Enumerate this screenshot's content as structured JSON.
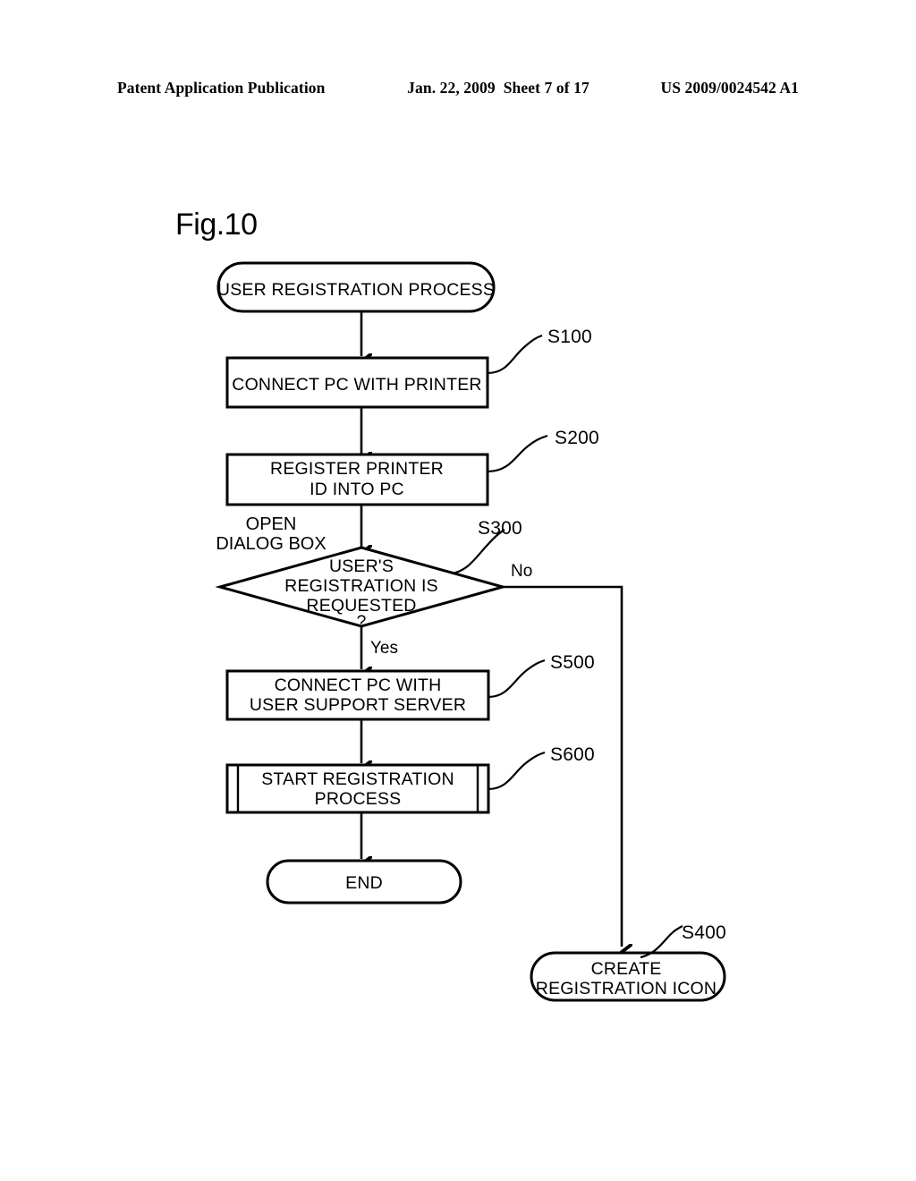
{
  "header": {
    "publication": "Patent Application Publication",
    "date": "Jan. 22, 2009",
    "sheet": "Sheet 7 of 17",
    "patent_number": "US 2009/0024542 A1"
  },
  "figure": {
    "label": "Fig.10"
  },
  "flowchart": {
    "nodes": {
      "start": {
        "text": "USER REGISTRATION PROCESS",
        "shape": "stadium"
      },
      "s100": {
        "text_line1": "CONNECT PC WITH PRINTER",
        "shape": "process",
        "step": "S100"
      },
      "s200": {
        "text_line1": "REGISTER PRINTER",
        "text_line2": "ID INTO PC",
        "shape": "process",
        "step": "S200"
      },
      "s300": {
        "text_line1": "USER'S",
        "text_line2": "REGISTRATION IS",
        "text_line3": "REQUESTED",
        "text_line4": "?",
        "shape": "decision",
        "step": "S300"
      },
      "s500": {
        "text_line1": "CONNECT PC WITH",
        "text_line2": "USER SUPPORT SERVER",
        "shape": "process",
        "step": "S500"
      },
      "s600": {
        "text_line1": "START REGISTRATION",
        "text_line2": "PROCESS",
        "shape": "predefined-process",
        "step": "S600"
      },
      "end": {
        "text": "END",
        "shape": "stadium"
      },
      "s400": {
        "text_line1": "CREATE",
        "text_line2": "REGISTRATION ICON",
        "shape": "stadium",
        "step": "S400"
      }
    },
    "branches": {
      "yes": "Yes",
      "no": "No"
    },
    "annotations": {
      "open_dialog_line1": "OPEN",
      "open_dialog_line2": "DIALOG BOX"
    },
    "colors": {
      "ink": "#000000",
      "paper": "#ffffff"
    }
  }
}
